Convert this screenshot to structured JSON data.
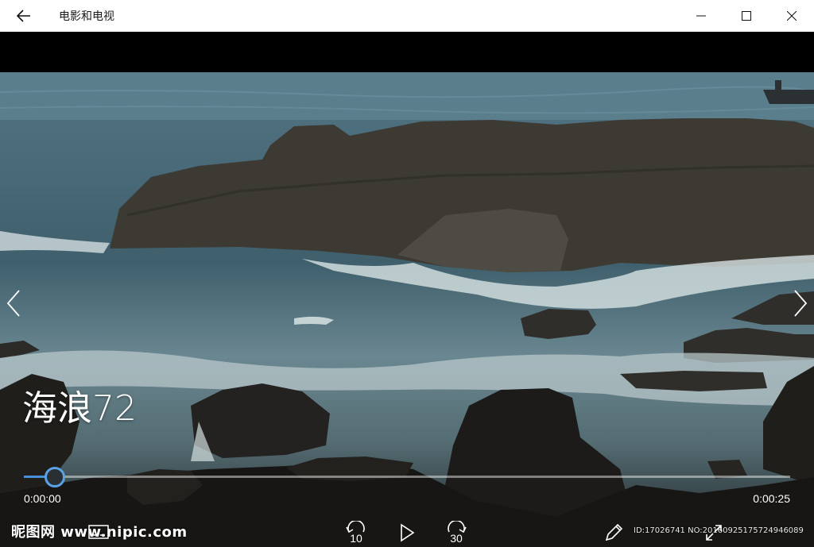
{
  "window": {
    "title": "电影和电视"
  },
  "media": {
    "title": "海浪72",
    "elapsed": "0:00:00",
    "total": "0:00:25",
    "progress_fraction": 0.04
  },
  "controls": {
    "skip_back_seconds": "10",
    "skip_forward_seconds": "30"
  },
  "watermarks": {
    "left": "昵图网 www.nipic.com",
    "right": "ID:17026741 NO:20160925175724946089"
  },
  "colors": {
    "accent": "#4a90d9",
    "titlebar": "#ffffff"
  },
  "icons": [
    "back-arrow-icon",
    "minimize-icon",
    "maximize-icon",
    "close-icon",
    "chevron-left-icon",
    "chevron-right-icon",
    "skip-back-icon",
    "play-icon",
    "skip-forward-icon",
    "pen-icon",
    "fullscreen-icon",
    "subtitles-icon"
  ]
}
